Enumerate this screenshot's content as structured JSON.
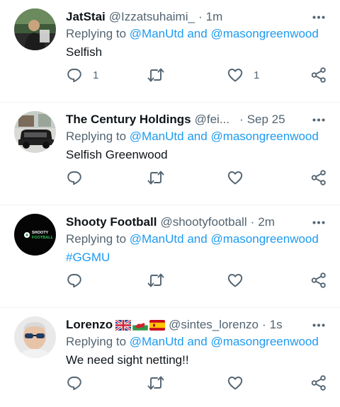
{
  "colors": {
    "link": "#1d9bf0",
    "secondary": "#536471",
    "text": "#0f1419",
    "divider": "#eff3f4"
  },
  "icons": {
    "more": "more-dots-icon",
    "reply": "reply-bubble-icon",
    "retweet": "retweet-icon",
    "like": "heart-icon",
    "share": "share-icon"
  },
  "tweets": [
    {
      "name": "JatStai",
      "handle": "@Izzatsuhaimi_",
      "dot": "·",
      "time": "1m",
      "replying_prefix": "Replying to",
      "mention1": "@ManUtd",
      "and": "and",
      "mention2": "@masongreenwood",
      "text": "Selfish",
      "reply_count": "1",
      "like_count": "1"
    },
    {
      "name": "The Century Holdings",
      "handle": "@fei...",
      "dot": "·",
      "time": "Sep 25",
      "replying_prefix": "Replying to",
      "mention1": "@ManUtd",
      "and": "and",
      "mention2": "@masongreenwood",
      "text": "Selfish Greenwood"
    },
    {
      "name": "Shooty Football",
      "handle": "@shootyfootball",
      "dot": "·",
      "time": "2m",
      "replying_prefix": "Replying to",
      "mention1": "@ManUtd",
      "and": "and",
      "mention2": "@masongreenwood",
      "text": "#GGMU",
      "avatar_text_1": "SHOOTY",
      "avatar_text_2": "FOOTBALL"
    },
    {
      "name": "Lorenzo",
      "handle": "@sintes_lorenzo",
      "dot": "·",
      "time": "1s",
      "replying_prefix": "Replying to",
      "mention1": "@ManUtd",
      "and": "and",
      "mention2": "@masongreenwood",
      "text": "We need sight netting!!"
    }
  ]
}
